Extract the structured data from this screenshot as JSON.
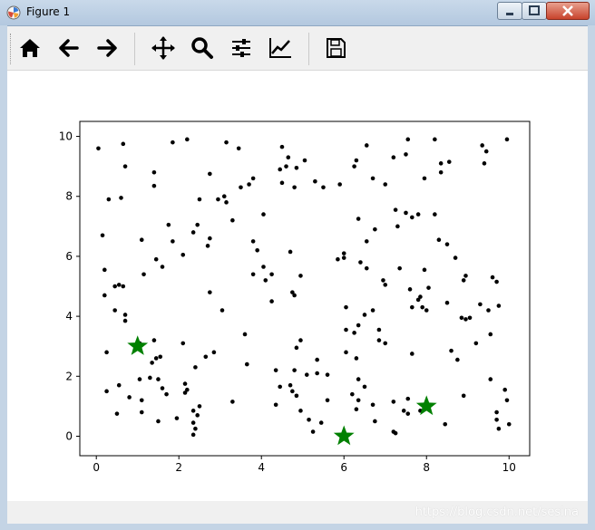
{
  "window": {
    "title": "Figure 1"
  },
  "toolbar": {
    "buttons": [
      {
        "name": "home-button",
        "icon": "home-icon"
      },
      {
        "name": "back-button",
        "icon": "arrow-left-icon"
      },
      {
        "name": "forward-button",
        "icon": "arrow-right-icon"
      },
      {
        "name": "pan-button",
        "icon": "move-icon"
      },
      {
        "name": "zoom-button",
        "icon": "magnifier-icon"
      },
      {
        "name": "configure-subplots-button",
        "icon": "sliders-icon"
      },
      {
        "name": "edit-axis-button",
        "icon": "chart-line-icon"
      },
      {
        "name": "save-button",
        "icon": "floppy-disk-icon"
      }
    ]
  },
  "status": {
    "watermark": "https://blog.csdn.net/sesina"
  },
  "chart_data": {
    "type": "scatter",
    "title": "",
    "xlabel": "",
    "ylabel": "",
    "xlim": [
      -0.4,
      10.5
    ],
    "ylim": [
      -0.65,
      10.5
    ],
    "xticks": [
      "0",
      "2",
      "4",
      "6",
      "8",
      "10"
    ],
    "yticks": [
      "0",
      "2",
      "4",
      "6",
      "8",
      "10"
    ],
    "grid": false,
    "legend": "none",
    "colors": {
      "points": "#000000",
      "centers": "#008000"
    },
    "series": [
      {
        "marker": "dot",
        "points": [
          [
            0.05,
            9.6
          ],
          [
            0.65,
            9.75
          ],
          [
            1.85,
            9.8
          ],
          [
            2.2,
            9.9
          ],
          [
            3.15,
            9.8
          ],
          [
            3.45,
            9.6
          ],
          [
            4.5,
            9.65
          ],
          [
            4.65,
            9.3
          ],
          [
            4.45,
            8.9
          ],
          [
            4.6,
            9.0
          ],
          [
            4.85,
            8.95
          ],
          [
            5.05,
            9.2
          ],
          [
            5.3,
            8.5
          ],
          [
            5.5,
            8.3
          ],
          [
            5.9,
            8.4
          ],
          [
            6.25,
            9.0
          ],
          [
            6.3,
            9.2
          ],
          [
            6.55,
            9.7
          ],
          [
            6.7,
            8.6
          ],
          [
            7.0,
            8.4
          ],
          [
            7.2,
            9.3
          ],
          [
            7.5,
            9.4
          ],
          [
            7.55,
            9.9
          ],
          [
            8.2,
            9.9
          ],
          [
            8.35,
            9.1
          ],
          [
            8.35,
            8.8
          ],
          [
            8.55,
            9.15
          ],
          [
            9.35,
            9.7
          ],
          [
            9.4,
            9.1
          ],
          [
            9.45,
            9.5
          ],
          [
            9.95,
            9.9
          ],
          [
            7.95,
            8.6
          ],
          [
            0.3,
            7.9
          ],
          [
            0.6,
            7.95
          ],
          [
            1.4,
            8.8
          ],
          [
            1.4,
            8.35
          ],
          [
            2.5,
            7.9
          ],
          [
            2.75,
            8.75
          ],
          [
            2.95,
            7.9
          ],
          [
            3.1,
            8.0
          ],
          [
            3.15,
            7.8
          ],
          [
            3.5,
            8.3
          ],
          [
            3.7,
            8.4
          ],
          [
            3.8,
            8.6
          ],
          [
            4.5,
            8.45
          ],
          [
            4.8,
            8.3
          ],
          [
            0.7,
            9.0
          ],
          [
            0.15,
            6.7
          ],
          [
            1.1,
            6.55
          ],
          [
            1.75,
            7.05
          ],
          [
            1.85,
            6.5
          ],
          [
            2.1,
            6.05
          ],
          [
            2.35,
            6.8
          ],
          [
            2.45,
            7.05
          ],
          [
            2.7,
            6.35
          ],
          [
            2.75,
            6.6
          ],
          [
            3.3,
            7.2
          ],
          [
            3.8,
            6.5
          ],
          [
            3.9,
            6.2
          ],
          [
            4.05,
            7.4
          ],
          [
            4.7,
            6.15
          ],
          [
            4.95,
            5.35
          ],
          [
            5.85,
            5.9
          ],
          [
            6.0,
            6.1
          ],
          [
            6.35,
            7.25
          ],
          [
            6.55,
            6.5
          ],
          [
            6.75,
            6.9
          ],
          [
            7.25,
            7.55
          ],
          [
            7.3,
            7.0
          ],
          [
            7.5,
            7.45
          ],
          [
            7.65,
            7.3
          ],
          [
            7.8,
            7.4
          ],
          [
            8.2,
            7.4
          ],
          [
            8.3,
            6.55
          ],
          [
            8.5,
            6.4
          ],
          [
            8.7,
            5.95
          ],
          [
            0.2,
            5.55
          ],
          [
            0.45,
            5.0
          ],
          [
            0.55,
            5.05
          ],
          [
            0.65,
            5.0
          ],
          [
            1.15,
            5.4
          ],
          [
            1.45,
            5.9
          ],
          [
            1.6,
            5.65
          ],
          [
            3.8,
            5.4
          ],
          [
            4.1,
            5.2
          ],
          [
            4.05,
            5.65
          ],
          [
            4.25,
            5.4
          ],
          [
            6.0,
            5.95
          ],
          [
            6.4,
            5.8
          ],
          [
            6.55,
            5.6
          ],
          [
            6.95,
            5.2
          ],
          [
            7.0,
            5.05
          ],
          [
            7.35,
            5.6
          ],
          [
            7.6,
            4.9
          ],
          [
            7.85,
            4.65
          ],
          [
            7.95,
            5.55
          ],
          [
            8.05,
            4.95
          ],
          [
            8.9,
            5.2
          ],
          [
            8.95,
            5.35
          ],
          [
            9.6,
            5.3
          ],
          [
            9.7,
            5.15
          ],
          [
            0.2,
            4.7
          ],
          [
            0.45,
            4.2
          ],
          [
            0.7,
            4.05
          ],
          [
            0.7,
            3.85
          ],
          [
            1.05,
            3.1
          ],
          [
            1.4,
            3.2
          ],
          [
            2.75,
            4.8
          ],
          [
            3.05,
            4.2
          ],
          [
            4.25,
            4.5
          ],
          [
            4.75,
            4.8
          ],
          [
            4.8,
            4.7
          ],
          [
            6.05,
            4.3
          ],
          [
            6.05,
            3.55
          ],
          [
            6.35,
            3.7
          ],
          [
            6.5,
            4.05
          ],
          [
            6.7,
            4.2
          ],
          [
            6.85,
            3.55
          ],
          [
            7.65,
            4.3
          ],
          [
            7.8,
            4.55
          ],
          [
            7.9,
            4.3
          ],
          [
            8.0,
            4.2
          ],
          [
            8.5,
            4.45
          ],
          [
            8.85,
            3.95
          ],
          [
            8.95,
            3.9
          ],
          [
            9.05,
            3.95
          ],
          [
            9.3,
            4.4
          ],
          [
            9.5,
            4.2
          ],
          [
            9.55,
            3.4
          ],
          [
            9.75,
            4.35
          ],
          [
            9.2,
            3.1
          ],
          [
            0.25,
            2.8
          ],
          [
            1.35,
            2.45
          ],
          [
            1.45,
            2.6
          ],
          [
            1.55,
            2.65
          ],
          [
            2.1,
            3.1
          ],
          [
            2.65,
            2.65
          ],
          [
            2.85,
            2.8
          ],
          [
            3.6,
            3.4
          ],
          [
            3.65,
            2.4
          ],
          [
            4.85,
            2.95
          ],
          [
            4.95,
            3.2
          ],
          [
            6.05,
            2.8
          ],
          [
            6.25,
            3.45
          ],
          [
            6.3,
            2.6
          ],
          [
            6.35,
            1.9
          ],
          [
            6.85,
            3.2
          ],
          [
            7.0,
            3.1
          ],
          [
            7.65,
            2.75
          ],
          [
            8.6,
            2.85
          ],
          [
            8.75,
            2.55
          ],
          [
            0.25,
            1.5
          ],
          [
            0.55,
            1.7
          ],
          [
            0.8,
            1.3
          ],
          [
            1.05,
            1.9
          ],
          [
            1.3,
            1.95
          ],
          [
            1.5,
            1.9
          ],
          [
            1.6,
            1.6
          ],
          [
            2.15,
            1.75
          ],
          [
            2.2,
            1.55
          ],
          [
            2.4,
            2.3
          ],
          [
            2.5,
            1.0
          ],
          [
            3.3,
            1.15
          ],
          [
            4.35,
            2.2
          ],
          [
            4.45,
            1.65
          ],
          [
            4.7,
            1.7
          ],
          [
            4.8,
            2.2
          ],
          [
            4.75,
            1.5
          ],
          [
            4.85,
            1.35
          ],
          [
            5.1,
            2.05
          ],
          [
            5.35,
            2.1
          ],
          [
            5.35,
            2.55
          ],
          [
            5.6,
            2.05
          ],
          [
            5.6,
            1.2
          ],
          [
            6.2,
            1.4
          ],
          [
            6.35,
            1.2
          ],
          [
            6.5,
            1.65
          ],
          [
            7.2,
            1.15
          ],
          [
            7.55,
            1.25
          ],
          [
            8.9,
            1.35
          ],
          [
            9.55,
            1.9
          ],
          [
            9.9,
            1.55
          ],
          [
            9.95,
            1.2
          ],
          [
            0.5,
            0.75
          ],
          [
            1.1,
            1.2
          ],
          [
            1.1,
            0.8
          ],
          [
            1.5,
            0.5
          ],
          [
            1.7,
            1.4
          ],
          [
            1.95,
            0.6
          ],
          [
            2.15,
            1.45
          ],
          [
            2.35,
            0.85
          ],
          [
            2.35,
            0.45
          ],
          [
            2.4,
            0.25
          ],
          [
            2.45,
            0.7
          ],
          [
            2.35,
            0.05
          ],
          [
            4.35,
            1.05
          ],
          [
            4.95,
            0.85
          ],
          [
            5.15,
            0.55
          ],
          [
            5.25,
            0.15
          ],
          [
            5.45,
            0.45
          ],
          [
            6.3,
            0.9
          ],
          [
            6.7,
            1.05
          ],
          [
            6.75,
            0.5
          ],
          [
            7.2,
            0.15
          ],
          [
            7.25,
            0.1
          ],
          [
            7.45,
            0.85
          ],
          [
            7.55,
            0.75
          ],
          [
            7.85,
            0.85
          ],
          [
            8.45,
            0.4
          ],
          [
            9.7,
            0.8
          ],
          [
            9.7,
            0.55
          ],
          [
            9.75,
            0.25
          ],
          [
            10.0,
            0.4
          ]
        ]
      },
      {
        "marker": "star",
        "points": [
          [
            1,
            3
          ],
          [
            6,
            0
          ],
          [
            8,
            1
          ]
        ]
      }
    ]
  }
}
